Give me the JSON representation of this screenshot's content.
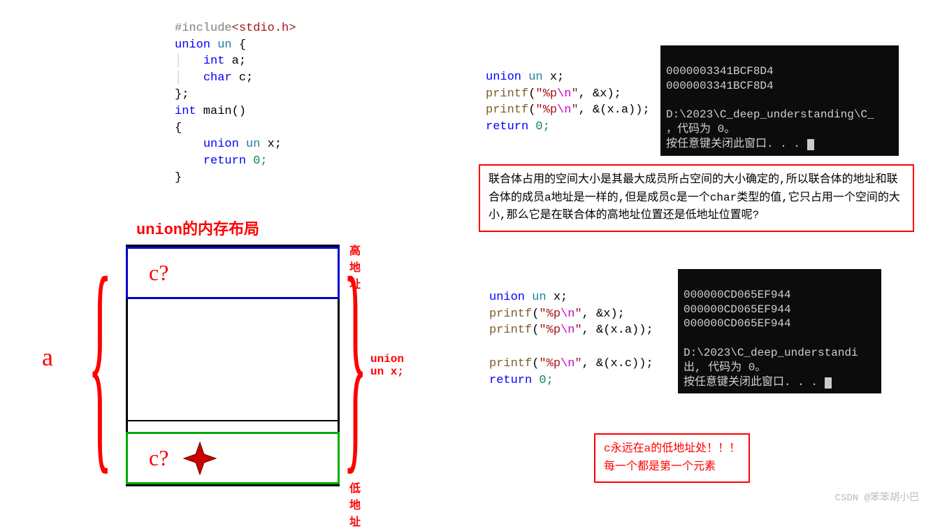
{
  "code_block1": {
    "l1_a": "#include",
    "l1_b": "<stdio.h>",
    "l2_a": "union",
    "l2_b": "un",
    "l2_c": " {",
    "l3_a": "int",
    "l3_b": " a;",
    "l4_a": "char",
    "l4_b": " c;",
    "l5": "};",
    "l6_a": "int",
    "l6_b": " main()",
    "l7": "{",
    "l8_a": "union",
    "l8_b": "un",
    "l8_c": " x;",
    "l9_a": "return",
    "l9_b": " 0;",
    "l10": "}"
  },
  "diagram": {
    "title": "union的内存布局",
    "high_addr": "高地址",
    "low_addr": "低地址",
    "right_label": "union un x;",
    "a_label": "a",
    "c_top": "c?",
    "c_bottom": "c?"
  },
  "code2": {
    "l1_a": "union",
    "l1_b": "un",
    "l1_c": " x;",
    "l2_a": "printf",
    "l2_b": "(",
    "l2_c": "\"%p",
    "l2_d": "\\n",
    "l2_e": "\"",
    "l2_f": ", &x);",
    "l3_a": "printf",
    "l3_b": "(",
    "l3_c": "\"%p",
    "l3_d": "\\n",
    "l3_e": "\"",
    "l3_f": ", &(x.a));",
    "l4_a": "return",
    "l4_b": " 0;"
  },
  "term1": {
    "l1": "0000003341BCF8D4",
    "l2": "0000003341BCF8D4",
    "l3": "",
    "l4": "D:\\2023\\C_deep_understanding\\C_",
    "l5": "，代码为 0。",
    "l6": "按任意键关闭此窗口. . . "
  },
  "explain1": "联合体占用的空间大小是其最大成员所占空间的大小确定的,所以联合体的地址和联合体的成员a地址是一样的,但是成员c是一个char类型的值,它只占用一个空间的大小,那么它是在联合体的高地址位置还是低地址位置呢?",
  "code3": {
    "l1_a": "union",
    "l1_b": "un",
    "l1_c": " x;",
    "l2_a": "printf",
    "l2_b": "(",
    "l2_c": "\"%p",
    "l2_d": "\\n",
    "l2_e": "\"",
    "l2_f": ", &x);",
    "l3_a": "printf",
    "l3_b": "(",
    "l3_c": "\"%p",
    "l3_d": "\\n",
    "l3_e": "\"",
    "l3_f": ", &(x.a));",
    "l4_a": "printf",
    "l4_b": "(",
    "l4_c": "\"%p",
    "l4_d": "\\n",
    "l4_e": "\"",
    "l4_f": ", &(x.c));",
    "l5_a": "return",
    "l5_b": " 0;"
  },
  "term2": {
    "l1": "000000CD065EF944",
    "l2": "000000CD065EF944",
    "l3": "000000CD065EF944",
    "l4": "",
    "l5": "D:\\2023\\C_deep_understandi",
    "l6": "出, 代码为 0。",
    "l7": "按任意键关闭此窗口. . . "
  },
  "conclusion": {
    "l1": "c永远在a的低地址处！！！",
    "l2": "每一个都是第一个元素"
  },
  "watermark": "CSDN @笨笨胡小巴"
}
